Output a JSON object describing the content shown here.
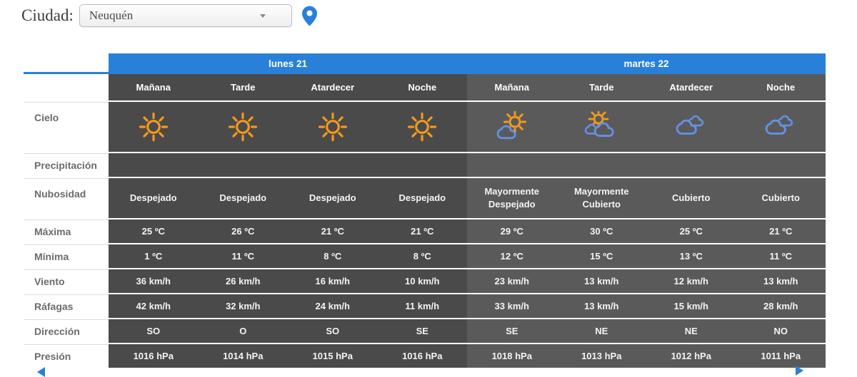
{
  "header": {
    "city_label": "Ciudad:",
    "city_value": "Neuquén"
  },
  "icons": {
    "location_pin": "location-pin-icon",
    "dropdown_arrow": "chevron-down-icon",
    "prev": "chevron-left-icon",
    "next": "chevron-right-icon"
  },
  "colors": {
    "accent_blue": "#2980d9",
    "sun_orange": "#f39a1d",
    "cloud_blue": "#6391e3",
    "day1_gray": "#4a4a4a",
    "day2_gray": "#5a5a5a"
  },
  "table": {
    "row_labels": [
      "Cielo",
      "Precipitación",
      "Nubosidad",
      "Máxima",
      "Mínima",
      "Viento",
      "Ráfagas",
      "Dirección",
      "Presión"
    ],
    "days": [
      {
        "title": "lunes 21",
        "periods": [
          "Mañana",
          "Tarde",
          "Atardecer",
          "Noche"
        ],
        "cielo_icons": [
          "sun-icon",
          "sun-icon",
          "sun-icon",
          "sun-icon"
        ],
        "precipitacion": [
          "",
          "",
          "",
          ""
        ],
        "nubosidad": [
          "Despejado",
          "Despejado",
          "Despejado",
          "Despejado"
        ],
        "maxima": [
          "25 ºC",
          "26 ºC",
          "21 ºC",
          "21 ºC"
        ],
        "minima": [
          "1 ºC",
          "11 ºC",
          "8 ºC",
          "8 ºC"
        ],
        "viento": [
          "36 km/h",
          "26 km/h",
          "16 km/h",
          "10 km/h"
        ],
        "rafagas": [
          "42 km/h",
          "32 km/h",
          "24 km/h",
          "11 km/h"
        ],
        "direccion": [
          "SO",
          "O",
          "SO",
          "SE"
        ],
        "presion": [
          "1016 hPa",
          "1014 hPa",
          "1015 hPa",
          "1016 hPa"
        ]
      },
      {
        "title": "martes 22",
        "periods": [
          "Mañana",
          "Tarde",
          "Atardecer",
          "Noche"
        ],
        "cielo_icons": [
          "sun-behind-cloud-icon",
          "sun-behind-clouds-icon",
          "clouds-icon",
          "clouds-icon"
        ],
        "precipitacion": [
          "",
          "",
          "",
          ""
        ],
        "nubosidad": [
          "Mayormente Despejado",
          "Mayormente Cubierto",
          "Cubierto",
          "Cubierto"
        ],
        "maxima": [
          "29 ºC",
          "30 ºC",
          "25 ºC",
          "21 ºC"
        ],
        "minima": [
          "12 ºC",
          "15 ºC",
          "13 ºC",
          "11 ºC"
        ],
        "viento": [
          "23 km/h",
          "13 km/h",
          "12 km/h",
          "13 km/h"
        ],
        "rafagas": [
          "33 km/h",
          "13 km/h",
          "15 km/h",
          "28 km/h"
        ],
        "direccion": [
          "SE",
          "NE",
          "NE",
          "NO"
        ],
        "presion": [
          "1018 hPa",
          "1013 hPa",
          "1012 hPa",
          "1011 hPa"
        ]
      }
    ]
  }
}
